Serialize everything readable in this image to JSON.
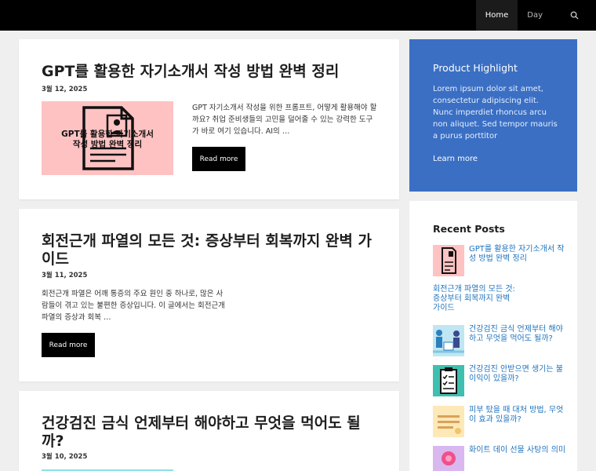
{
  "nav": {
    "items": [
      {
        "label": "Home",
        "active": true
      },
      {
        "label": "Day",
        "active": false
      }
    ]
  },
  "posts": [
    {
      "title": "GPT를 활용한 자기소개서 작성 방법 완벽 정리",
      "date": "3월 12, 2025",
      "thumb_text_line1": "GPT를 활용한 자기소개서",
      "thumb_text_line2": "작성 방법 완벽 정리",
      "excerpt": "GPT 자기소개서 작성을 위한 프롬프트, 어떻게 활용해야 할까요? 취업 준비생들의 고민을 덜어줄 수 있는 강력한 도구가 바로 여기 있습니다. AI의 …",
      "read_more": "Read more"
    },
    {
      "title": "회전근개 파열의 모든 것: 증상부터 회복까지 완벽 가이드",
      "date": "3월 11, 2025",
      "excerpt": "회전근개 파열은 어깨 통증의 주요 원인 중 하나로, 많은 사람들이 겪고 있는 불편한 증상입니다. 이 글에서는 회전근개 파열의 증상과 회복 …",
      "read_more": "Read more"
    },
    {
      "title": "건강검진 금식 언제부터 해야하고 무엇을 먹어도 될까?",
      "date": "3월 10, 2025"
    }
  ],
  "highlight": {
    "title": "Product Highlight",
    "text": "Lorem ipsum dolor sit amet, consectetur adipiscing elit. Nunc imperdiet rhoncus arcu non aliquet. Sed tempor mauris a purus porttitor",
    "link": "Learn more",
    "bg_color": "#3a6fc4"
  },
  "recent": {
    "title": "Recent Posts",
    "items": [
      {
        "label": "GPT를 활용한 자기소개서 작성 방법 완벽 정리",
        "thumb": "document-icon"
      },
      {
        "label": "회전근개 파열의 모든 것: 증상부터 회복까지 완벽 가이드",
        "thumb": "none"
      },
      {
        "label": "건강검진 금식 언제부터 해야하고 무엇을 먹어도 될까?",
        "thumb": "medical-illustration"
      },
      {
        "label": "건강검진 안받으면 생기는 불이익이 있을까?",
        "thumb": "clipboard-icon"
      },
      {
        "label": "피부 탔을 때 대처 방법, 무엇이 효과 있을까?",
        "thumb": "skin-illustration"
      },
      {
        "label": "화이트 데이 선물 사탕의 의미",
        "thumb": "candy-illustration"
      }
    ]
  },
  "colors": {
    "accent": "#1e73be",
    "topbar": "#000000",
    "thumb_pink": "#ffc2c2"
  }
}
